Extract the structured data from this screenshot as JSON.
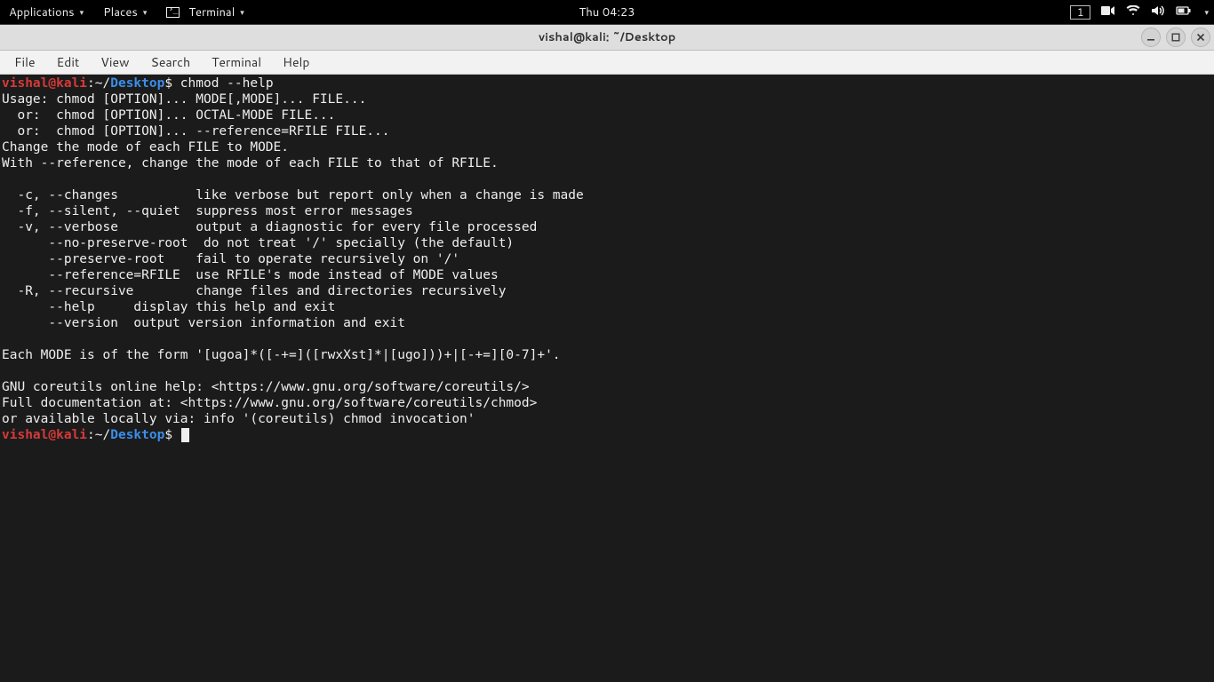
{
  "topbar": {
    "applications": "Applications",
    "places": "Places",
    "terminal_label": "Terminal",
    "clock": "Thu 04:23",
    "workspace": "1"
  },
  "window": {
    "title": "vishal@kali: ~/Desktop"
  },
  "menubar": {
    "file": "File",
    "edit": "Edit",
    "view": "View",
    "search": "Search",
    "terminal": "Terminal",
    "help": "Help"
  },
  "prompt": {
    "user_host": "vishal@kali",
    "colon": ":",
    "tilde": "~/",
    "path": "Desktop",
    "dollar": "$"
  },
  "command1": " chmod --help",
  "output": [
    "Usage: chmod [OPTION]... MODE[,MODE]... FILE...",
    "  or:  chmod [OPTION]... OCTAL-MODE FILE...",
    "  or:  chmod [OPTION]... --reference=RFILE FILE...",
    "Change the mode of each FILE to MODE.",
    "With --reference, change the mode of each FILE to that of RFILE.",
    "",
    "  -c, --changes          like verbose but report only when a change is made",
    "  -f, --silent, --quiet  suppress most error messages",
    "  -v, --verbose          output a diagnostic for every file processed",
    "      --no-preserve-root  do not treat '/' specially (the default)",
    "      --preserve-root    fail to operate recursively on '/'",
    "      --reference=RFILE  use RFILE's mode instead of MODE values",
    "  -R, --recursive        change files and directories recursively",
    "      --help     display this help and exit",
    "      --version  output version information and exit",
    "",
    "Each MODE is of the form '[ugoa]*([-+=]([rwxXst]*|[ugo]))+|[-+=][0-7]+'.",
    "",
    "GNU coreutils online help: <https://www.gnu.org/software/coreutils/>",
    "Full documentation at: <https://www.gnu.org/software/coreutils/chmod>",
    "or available locally via: info '(coreutils) chmod invocation'"
  ]
}
